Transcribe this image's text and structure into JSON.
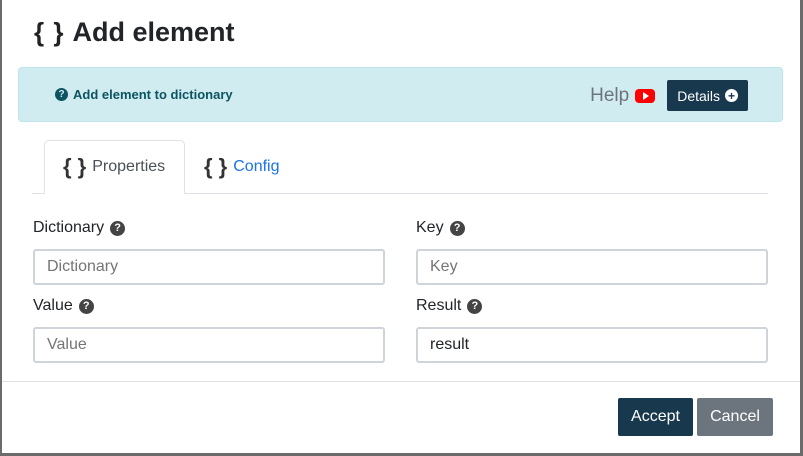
{
  "dialog": {
    "title_icon": "{ }",
    "title": "Add element"
  },
  "banner": {
    "description": "Add element to dictionary",
    "help_label": "Help",
    "details_label": "Details",
    "colors": {
      "background": "#d1ecf1",
      "text": "#0c5460"
    }
  },
  "tabs": [
    {
      "icon": "{ }",
      "label": "Properties",
      "active": true
    },
    {
      "icon": "{ }",
      "label": "Config",
      "active": false
    }
  ],
  "fields": {
    "dictionary": {
      "label": "Dictionary",
      "value": "",
      "placeholder": "Dictionary"
    },
    "key": {
      "label": "Key",
      "value": "",
      "placeholder": "Key"
    },
    "value": {
      "label": "Value",
      "value": "",
      "placeholder": "Value"
    },
    "result": {
      "label": "Result",
      "value": "result",
      "placeholder": ""
    }
  },
  "footer": {
    "accept_label": "Accept",
    "cancel_label": "Cancel",
    "colors": {
      "accept": "#17384d",
      "cancel": "#6c757d"
    }
  },
  "icons": [
    "braces-icon",
    "question-circle-icon",
    "youtube-icon",
    "plus-circle-icon"
  ]
}
